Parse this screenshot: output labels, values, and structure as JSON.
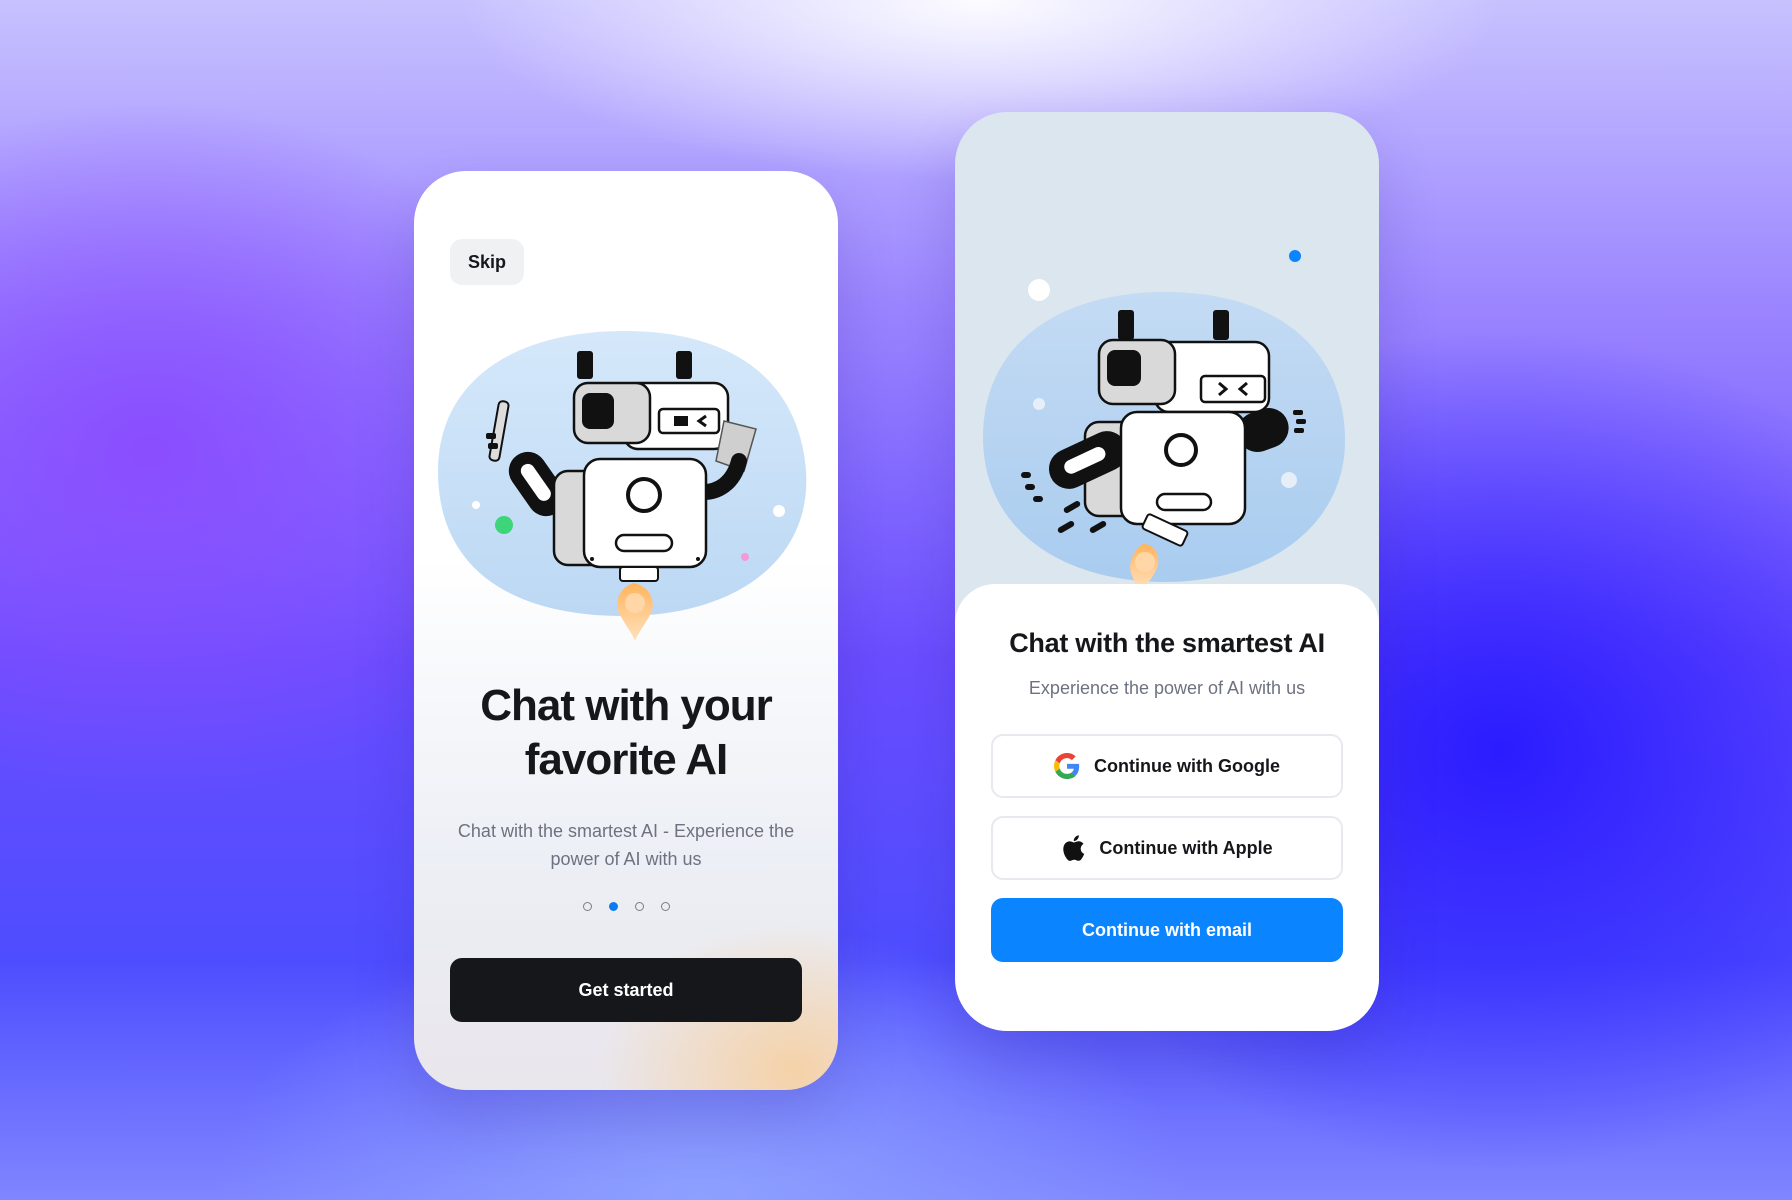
{
  "onboarding": {
    "skip_label": "Skip",
    "title": "Chat with your\nfavorite AI",
    "subtitle": "Chat with the smartest AI - Experience the power of AI with us",
    "pagination": {
      "count": 4,
      "active_index": 1
    },
    "cta_label": "Get started"
  },
  "signin": {
    "title": "Chat with the smartest AI",
    "subtitle": "Experience the power of AI with us",
    "google_label": "Continue with Google",
    "apple_label": "Continue with Apple",
    "email_label": "Continue with email"
  },
  "icons": {
    "google": "google-icon",
    "apple": "apple-icon",
    "robot": "robot-illustration"
  },
  "colors": {
    "primary_blue": "#0a84ff",
    "dark_button": "#15171a",
    "active_dot": "#0a7cf0",
    "illustration_blob": "#cfe4f8"
  }
}
